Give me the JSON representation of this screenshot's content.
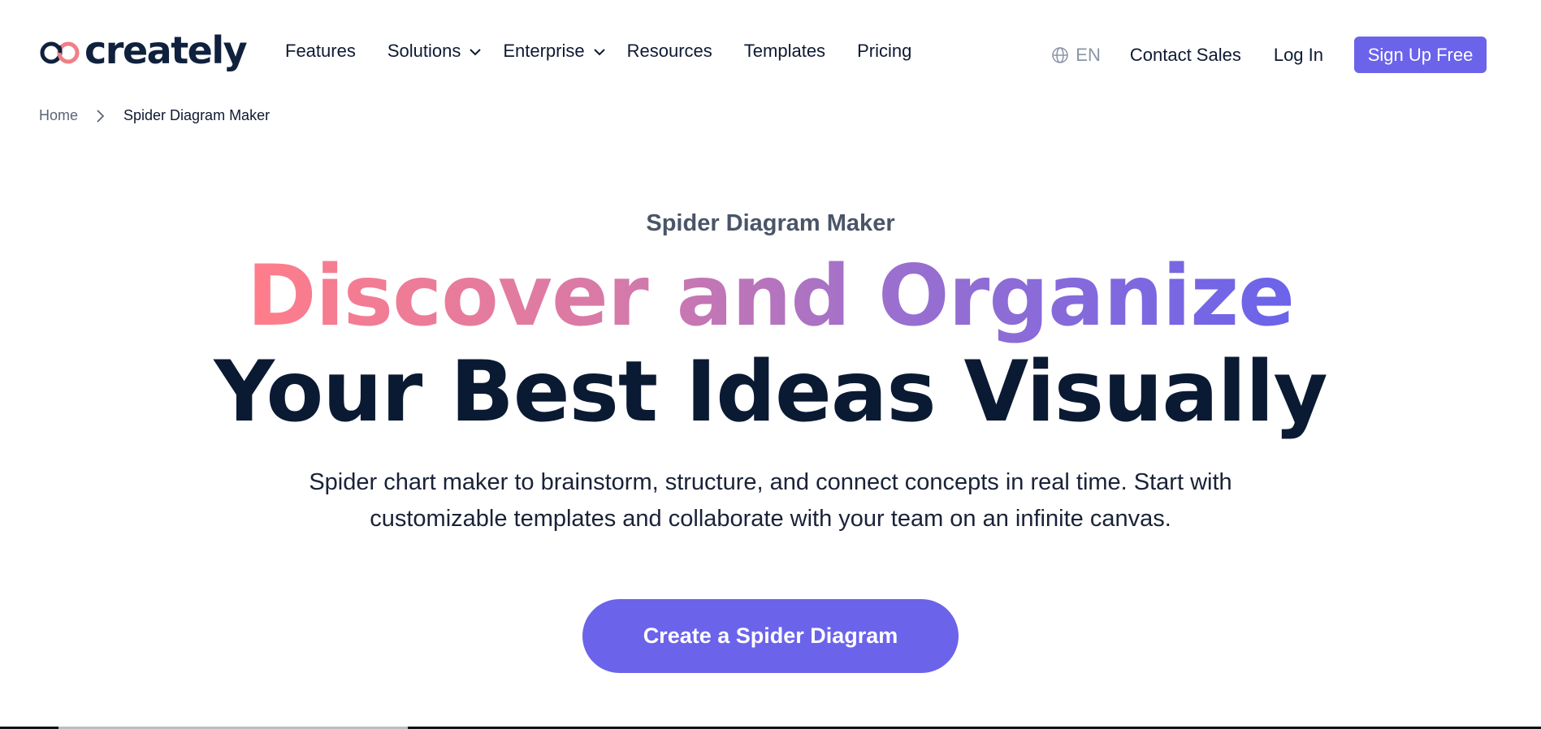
{
  "brand": {
    "name": "creately",
    "colors": {
      "accent": "#6b63ea",
      "logo_pink": "#f07f86",
      "logo_dark": "#10213d"
    }
  },
  "nav": {
    "items": [
      {
        "label": "Features",
        "has_dropdown": false
      },
      {
        "label": "Solutions",
        "has_dropdown": true
      },
      {
        "label": "Enterprise",
        "has_dropdown": true
      },
      {
        "label": "Resources",
        "has_dropdown": false
      },
      {
        "label": "Templates",
        "has_dropdown": false
      },
      {
        "label": "Pricing",
        "has_dropdown": false
      }
    ],
    "language": "EN",
    "contact_sales": "Contact Sales",
    "log_in": "Log In",
    "sign_up": "Sign Up Free"
  },
  "breadcrumb": {
    "home": "Home",
    "current": "Spider Diagram Maker"
  },
  "hero": {
    "eyebrow": "Spider Diagram Maker",
    "headline_line1": "Discover and Organize",
    "headline_line2": "Your Best Ideas Visually",
    "subtitle_line1": "Spider chart maker to brainstorm, structure, and connect concepts in real time. Start with",
    "subtitle_line2": "customizable templates and collaborate with your team on an infinite canvas.",
    "cta": "Create a Spider Diagram",
    "gradient": [
      "#ff7d8a",
      "#d77aa8",
      "#9a6fcf",
      "#6b63ea"
    ]
  }
}
